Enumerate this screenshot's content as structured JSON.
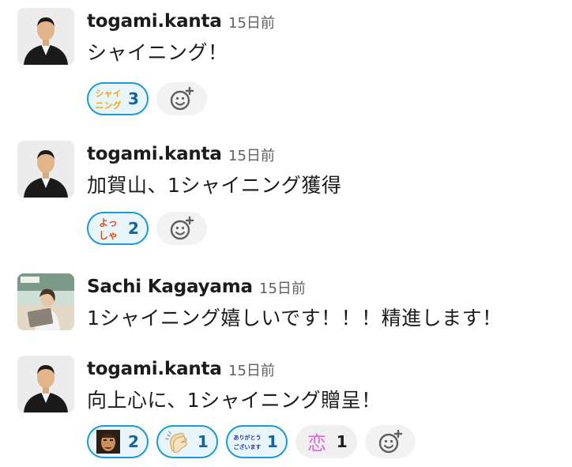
{
  "messages": [
    {
      "user": "togami.kanta",
      "time": "15日前",
      "text": "シャイニング！",
      "reactions": [
        {
          "emoji_name": "shining-emoji",
          "emoji_text_1": "シャイ",
          "emoji_text_2": "ニング",
          "count": "3",
          "active": true
        }
      ]
    },
    {
      "user": "togami.kanta",
      "time": "15日前",
      "text": "加賀山、1シャイニング獲得",
      "reactions": [
        {
          "emoji_name": "yossha-emoji",
          "emoji_text_1": "よっ",
          "emoji_text_2": "しゃ",
          "count": "2",
          "active": true
        }
      ]
    },
    {
      "user": "Sachi Kagayama",
      "time": "15日前",
      "text": "1シャイニング嬉しいです！！！精進します！",
      "reactions": []
    },
    {
      "user": "togami.kanta",
      "time": "15日前",
      "text": "向上心に、1シャイニング贈呈！",
      "reactions": [
        {
          "emoji_name": "face-emoji",
          "count": "2",
          "active": true
        },
        {
          "emoji_name": "clapping-hands-emoji",
          "count": "1",
          "active": true
        },
        {
          "emoji_name": "arigatou-emoji",
          "emoji_text_1": "ありがとう",
          "emoji_text_2": "ございます",
          "count": "1",
          "active": true
        },
        {
          "emoji_name": "koi-emoji",
          "emoji_text_1": "恋",
          "count": "1",
          "active": false
        }
      ]
    }
  ],
  "colors": {
    "reaction_active_border": "#1d9bd1",
    "reaction_active_bg": "#e8f5fa",
    "reaction_count_active": "#1264a3",
    "timestamp": "#616061"
  },
  "icons": {
    "add_reaction": "add-reaction-icon",
    "avatar_togami": "avatar",
    "avatar_sachi": "avatar"
  }
}
